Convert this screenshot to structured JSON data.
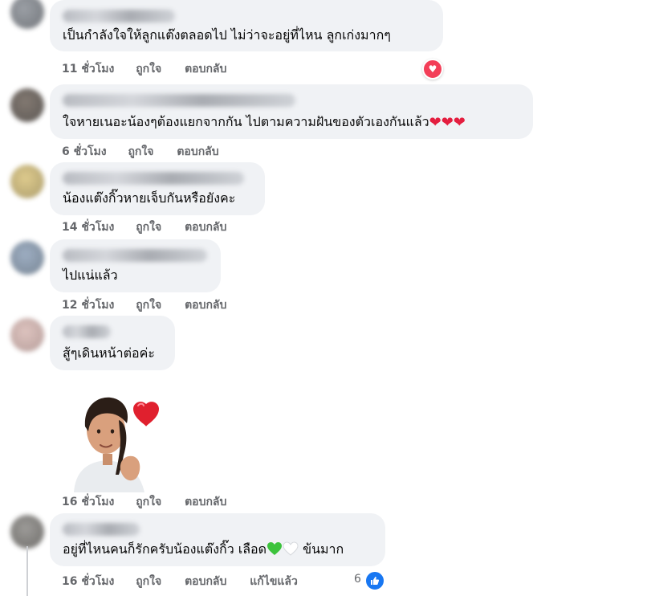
{
  "comments": [
    {
      "text": "เป็นกำลังใจให้ลูกแต๊งตลอดไป ไม่ว่าจะอยู่ที่ไหน ลูกเก่งมากๆ",
      "time": "11 ชั่วโมง",
      "like": "ถูกใจ",
      "reply": "ตอบกลับ",
      "reaction": "love"
    },
    {
      "text": "ใจหายเนอะน้องๆต้องแยกจากกัน ไปตามความฝันของตัวเองกันแล้ว",
      "emoji": "❤❤❤",
      "time": "6 ชั่วโมง",
      "like": "ถูกใจ",
      "reply": "ตอบกลับ"
    },
    {
      "text": "น้องแต๊งกิ๊วหายเจ็บกันหรือยังคะ",
      "time": "14 ชั่วโมง",
      "like": "ถูกใจ",
      "reply": "ตอบกลับ"
    },
    {
      "text": "ไปแน่แล้ว",
      "time": "12 ชั่วโมง",
      "like": "ถูกใจ",
      "reply": "ตอบกลับ"
    },
    {
      "text": "สู้ๆเดินหน้าต่อค่ะ",
      "time": "",
      "like": "",
      "reply": ""
    },
    {
      "sticker": "avatar-heart-sticker",
      "time": "16 ชั่วโมง",
      "like": "ถูกใจ",
      "reply": "ตอบกลับ"
    },
    {
      "text_before": "อยู่ที่ไหนคนก็รักครับน้องแต๊งกิ๊ว เลือด",
      "text_after": "ข้นมาก",
      "time": "16 ชั่วโมง",
      "like": "ถูกใจ",
      "reply": "ตอบกลับ",
      "edited": "แก้ไขแล้ว",
      "like_count": "6"
    }
  ],
  "colors": {
    "bubble": "#f0f2f5",
    "meta": "#65676b",
    "love": "#f33e58",
    "like": "#1877f2"
  }
}
